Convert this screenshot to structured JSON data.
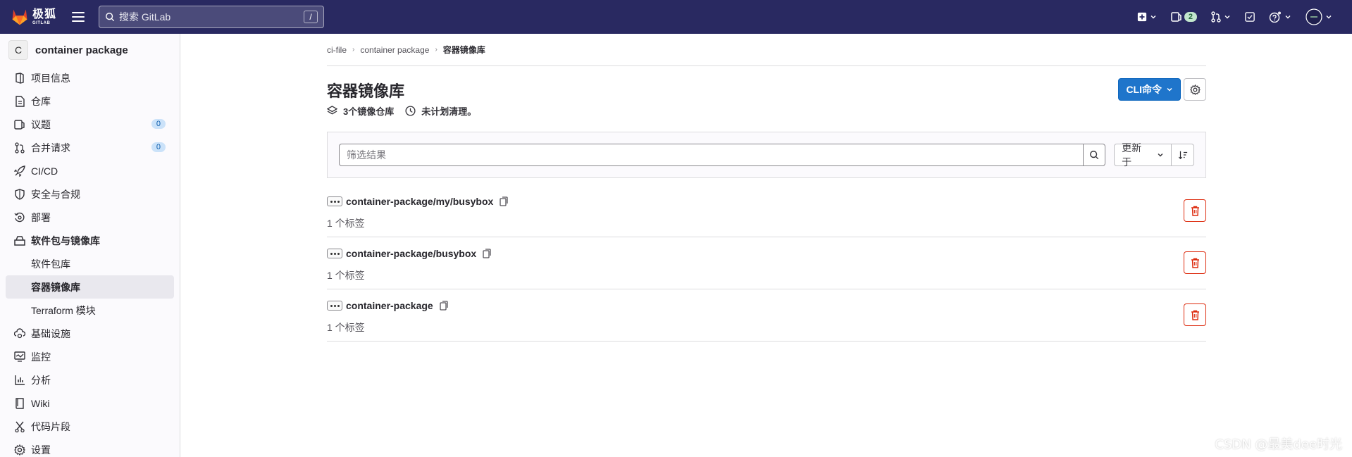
{
  "topbar": {
    "logo_text": "极狐",
    "logo_sub": "GITLAB",
    "search_placeholder": "搜索 GitLab",
    "search_shortcut": "/",
    "issues_count": "2"
  },
  "sidebar": {
    "project_avatar": "C",
    "project_name": "container package",
    "items": [
      {
        "label": "项目信息",
        "icon": "project-icon"
      },
      {
        "label": "仓库",
        "icon": "doc-icon"
      },
      {
        "label": "议题",
        "icon": "issues-icon",
        "count": "0"
      },
      {
        "label": "合并请求",
        "icon": "merge-request-icon",
        "count": "0"
      },
      {
        "label": "CI/CD",
        "icon": "rocket-icon"
      },
      {
        "label": "安全与合规",
        "icon": "shield-icon"
      },
      {
        "label": "部署",
        "icon": "deployments-icon"
      },
      {
        "label": "软件包与镜像库",
        "icon": "package-icon"
      }
    ],
    "subitems": [
      {
        "label": "软件包库"
      },
      {
        "label": "容器镜像库"
      },
      {
        "label": "Terraform 模块"
      }
    ],
    "items_after": [
      {
        "label": "基础设施",
        "icon": "cloud-gear-icon"
      },
      {
        "label": "监控",
        "icon": "monitor-icon"
      },
      {
        "label": "分析",
        "icon": "chart-icon"
      },
      {
        "label": "Wiki",
        "icon": "book-icon"
      },
      {
        "label": "代码片段",
        "icon": "snippet-icon"
      },
      {
        "label": "设置",
        "icon": "settings-icon"
      }
    ]
  },
  "breadcrumb": [
    "ci-file",
    "container package",
    "容器镜像库"
  ],
  "page": {
    "title": "容器镜像库",
    "repo_count": "3个镜像仓库",
    "cleanup": "未计划清理。",
    "cli_button": "CLI命令"
  },
  "filter": {
    "placeholder": "筛选结果",
    "sort_label": "更新于"
  },
  "repositories": [
    {
      "name": "container-package/my/busybox",
      "tags": "1 个标签"
    },
    {
      "name": "container-package/busybox",
      "tags": "1 个标签"
    },
    {
      "name": "container-package",
      "tags": "1 个标签"
    }
  ],
  "watermark": "CSDN @最美dee时光",
  "colors": {
    "topbar": "#292961",
    "primary": "#1f75cb",
    "danger": "#dd2b0e"
  }
}
